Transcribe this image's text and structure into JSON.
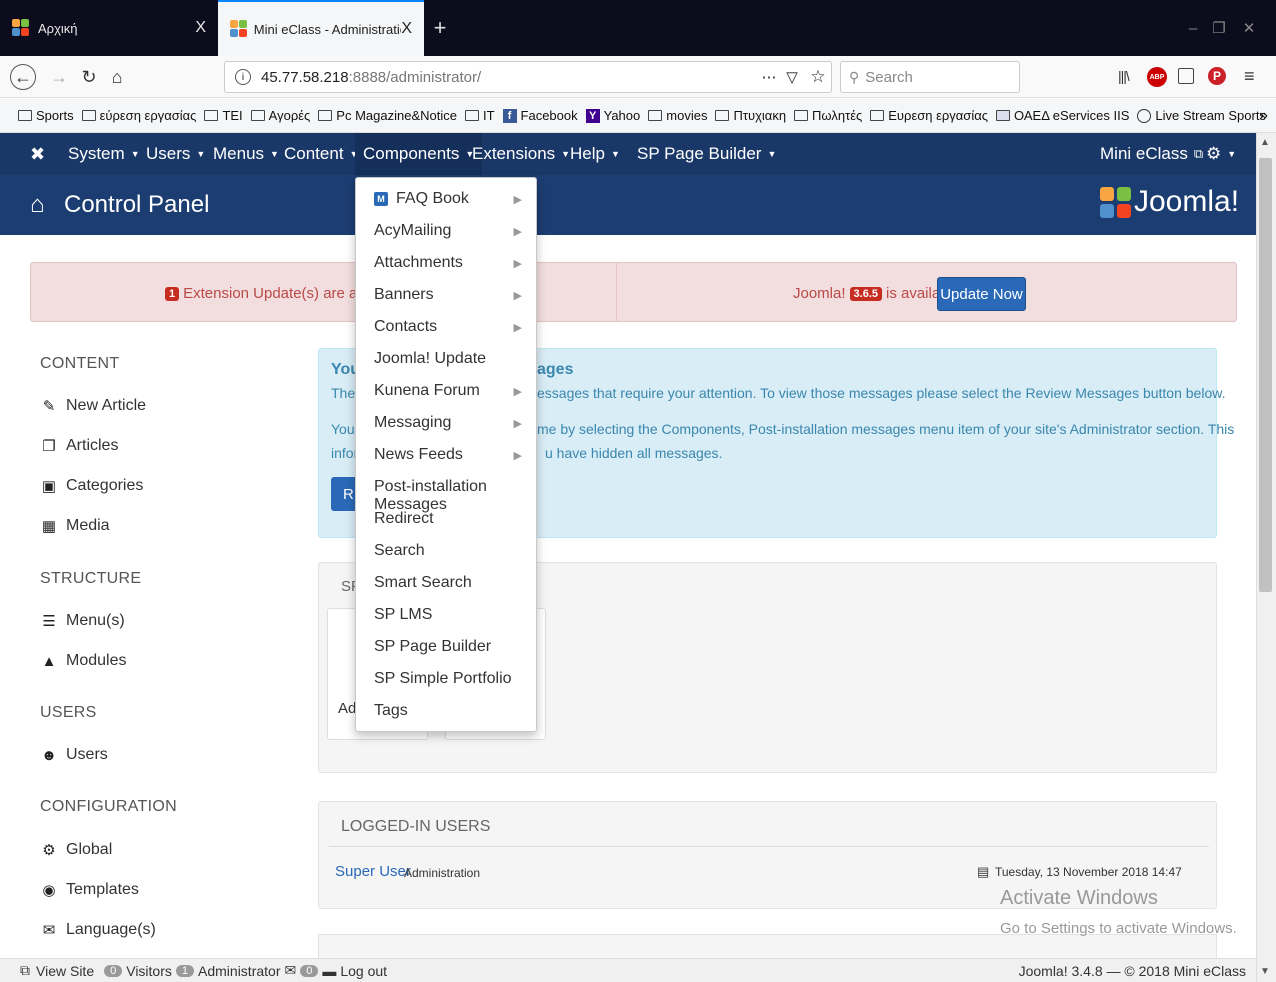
{
  "browser": {
    "tabs": [
      {
        "title": "Αρχική"
      },
      {
        "title": "Mini eClass - Administration - "
      }
    ],
    "tab_close": "X",
    "url_host": "45.77.58.218",
    "url_rest": ":8888/administrator/",
    "search_placeholder": "Search",
    "bookmarks": [
      "Sports",
      "εύρεση εργασίας",
      "TEI",
      "Αγορές",
      "Pc Magazine&Notice",
      "IT",
      "Facebook",
      "Yahoo",
      "movies",
      "Πτυχιακη",
      "Πωλητές",
      "Ευρεση εργασίας",
      "ΟΑΕΔ eServices IIS",
      "Live Stream Sports"
    ]
  },
  "joomla": {
    "menu": [
      "System",
      "Users",
      "Menus",
      "Content",
      "Components",
      "Extensions",
      "Help",
      "SP Page Builder"
    ],
    "site_link": "Mini eClass",
    "page_title": "Control Panel",
    "brand": "Joomla!",
    "alert_count": "1",
    "alert_text": "Extension Update(s) are availabl",
    "joomla_text": "Joomla!",
    "joomla_version": "3.6.5",
    "available_text": "is available:",
    "update_button": "Update Now"
  },
  "sidebar": {
    "content_head": "CONTENT",
    "content_items": [
      "New Article",
      "Articles",
      "Categories",
      "Media"
    ],
    "structure_head": "STRUCTURE",
    "structure_items": [
      "Menu(s)",
      "Modules"
    ],
    "users_head": "USERS",
    "users_items": [
      "Users"
    ],
    "config_head": "CONFIGURATION",
    "config_items": [
      "Global",
      "Templates",
      "Language(s)"
    ]
  },
  "info": {
    "title_left": "You",
    "title_right": "ages",
    "line1_left": "Ther",
    "line1_right": "essages that require your attention. To view those messages please select the Review Messages button below.",
    "line2_left": "You",
    "line2_right": "me by selecting the Components, Post-installation messages menu item of your site's Administrator section. This",
    "line3_left": "infor",
    "line3_right": "u have hidden all messages.",
    "button_frag": "R"
  },
  "well": {
    "title_frag": "SP",
    "card_frag": "Ad"
  },
  "logged": {
    "title": "LOGGED-IN USERS",
    "user": "Super User",
    "role": "Administration",
    "date": "Tuesday, 13 November 2018 14:47"
  },
  "components_menu": [
    "FAQ Book",
    "AcyMailing",
    "Attachments",
    "Banners",
    "Contacts",
    "Joomla! Update",
    "Kunena Forum",
    "Messaging",
    "News Feeds",
    "Post-installation Messages",
    "Redirect",
    "Search",
    "Smart Search",
    "SP LMS",
    "SP Page Builder",
    "SP Simple Portfolio",
    "Tags"
  ],
  "statusbar": {
    "view_site": "View Site",
    "visitors_count": "0",
    "visitors": "Visitors",
    "admin_count": "1",
    "admin": "Administrator",
    "msg_count": "0",
    "logout": "Log out",
    "footer": "Joomla! 3.4.8 — © 2018 Mini eClass"
  },
  "watermark": {
    "line1": "Activate Windows",
    "line2": "Go to Settings to activate Windows."
  }
}
